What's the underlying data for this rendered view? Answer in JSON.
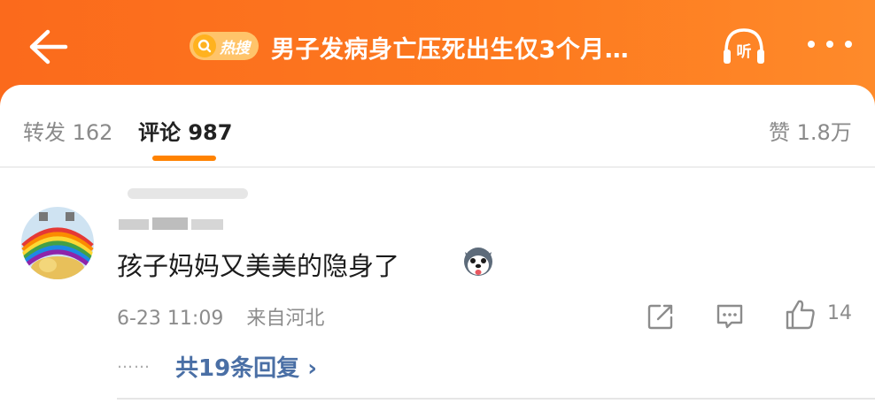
{
  "header": {
    "hot_badge": "热搜",
    "title": "男子发病身亡压死出生仅3个月…"
  },
  "tabs": {
    "repost": "转发 162",
    "comment": "评论 987",
    "like": "赞 1.8万"
  },
  "comment": {
    "text": "孩子妈妈又美美的隐身了",
    "time": "6-23 11:09",
    "location": "来自河北",
    "like_count": "14",
    "replies_label": "共19条回复 ›",
    "replies_prefix": "……"
  },
  "colors": {
    "header": "#fd7a1f",
    "tab_indicator": "#ff8200",
    "link": "#4a6fa5"
  },
  "icons": [
    "back-arrow-icon",
    "hot-search-icon",
    "listen-icon",
    "more-icon",
    "share-icon",
    "comment-icon",
    "like-icon",
    "emoji-husky-icon"
  ]
}
